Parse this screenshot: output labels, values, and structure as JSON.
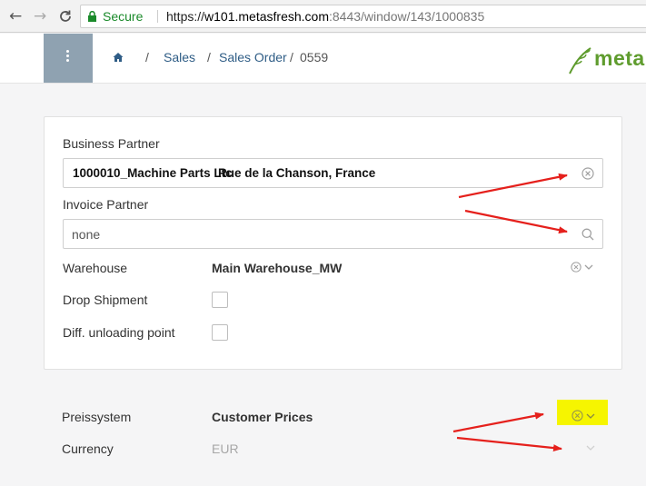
{
  "browser": {
    "secure_label": "Secure",
    "url": "https://w101.metasfresh.com:8443/window/143/1000835",
    "url_host": "w101.metasfresh.com",
    "url_path": ":8443/window/143/1000835"
  },
  "header": {
    "breadcrumb": [
      "Sales",
      "Sales Order",
      "0559"
    ],
    "logo_text": "meta"
  },
  "form": {
    "business_partner": {
      "label": "Business Partner",
      "value_id": "1000010_Machine Parts Ltc",
      "value_addr": "Rue de la Chanson, France"
    },
    "invoice_partner": {
      "label": "Invoice Partner",
      "value": "none"
    },
    "warehouse": {
      "label": "Warehouse",
      "value": "Main Warehouse_MW"
    },
    "drop_shipment": {
      "label": "Drop Shipment",
      "checked": false
    },
    "diff_unloading": {
      "label": "Diff. unloading point",
      "checked": false
    }
  },
  "pricing": {
    "preissystem": {
      "label": "Preissystem",
      "value": "Customer Prices"
    },
    "currency": {
      "label": "Currency",
      "value": "EUR"
    }
  },
  "colors": {
    "accent_link": "#2f5d86",
    "menu_button": "#8fa2b1",
    "logo_green": "#5f9c2e",
    "annotation_arrow": "#e5201c",
    "highlight": "#f6f500"
  }
}
